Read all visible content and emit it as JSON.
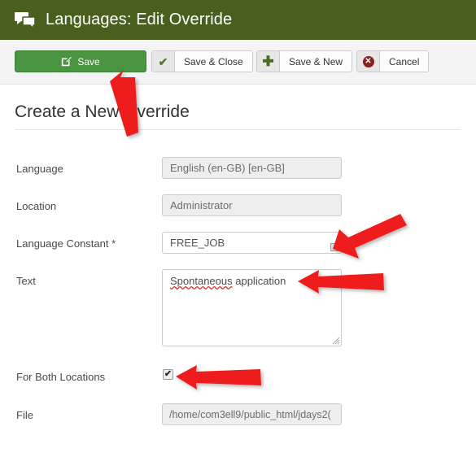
{
  "header": {
    "icon": "comments-icon",
    "title": "Languages: Edit Override"
  },
  "toolbar": {
    "buttons": [
      {
        "name": "save-button",
        "label": "Save",
        "icon": "edit-square-icon",
        "style": "primary"
      },
      {
        "name": "save-close-button",
        "label": "Save & Close",
        "icon": "check-icon",
        "style": "default"
      },
      {
        "name": "save-new-button",
        "label": "Save & New",
        "icon": "plus-icon",
        "style": "default"
      },
      {
        "name": "cancel-button",
        "label": "Cancel",
        "icon": "cancel-circle-icon",
        "style": "default"
      }
    ],
    "save_label": "Save",
    "save_close_label": "Save & Close",
    "save_new_label": "Save & New",
    "cancel_label": "Cancel"
  },
  "page": {
    "heading": "Create a New Override"
  },
  "form": {
    "language": {
      "label": "Language",
      "value": "English (en-GB) [en-GB]",
      "readonly": true
    },
    "location": {
      "label": "Location",
      "value": "Administrator",
      "readonly": true
    },
    "language_constant": {
      "label": "Language Constant *",
      "value": "FREE_JOB",
      "readonly": false,
      "required": true
    },
    "text": {
      "label": "Text",
      "value": "Spontaneous application",
      "misspelled_word": "Spontaneous",
      "rest": " application",
      "readonly": false
    },
    "for_both_locations": {
      "label": "For Both Locations",
      "checked": true,
      "check_glyph": "✔"
    },
    "file": {
      "label": "File",
      "value": "/home/com3ell9/public_html/jdays2(",
      "readonly": true
    }
  },
  "annotations": {
    "color": "#ee1c1c",
    "arrows": [
      {
        "name": "arrow-to-save-button",
        "target": "save-button"
      },
      {
        "name": "arrow-to-language-constant",
        "target": "language-constant-input"
      },
      {
        "name": "arrow-to-text-field",
        "target": "text-textarea"
      },
      {
        "name": "arrow-to-both-locations",
        "target": "for-both-locations-checkbox"
      }
    ]
  },
  "colors": {
    "header_green": "#495f20",
    "save_green": "#4a9441",
    "toolbar_bg": "#f4f4f4",
    "readonly_field": "#eeeeee",
    "annotation_red": "#ee1c1c"
  }
}
